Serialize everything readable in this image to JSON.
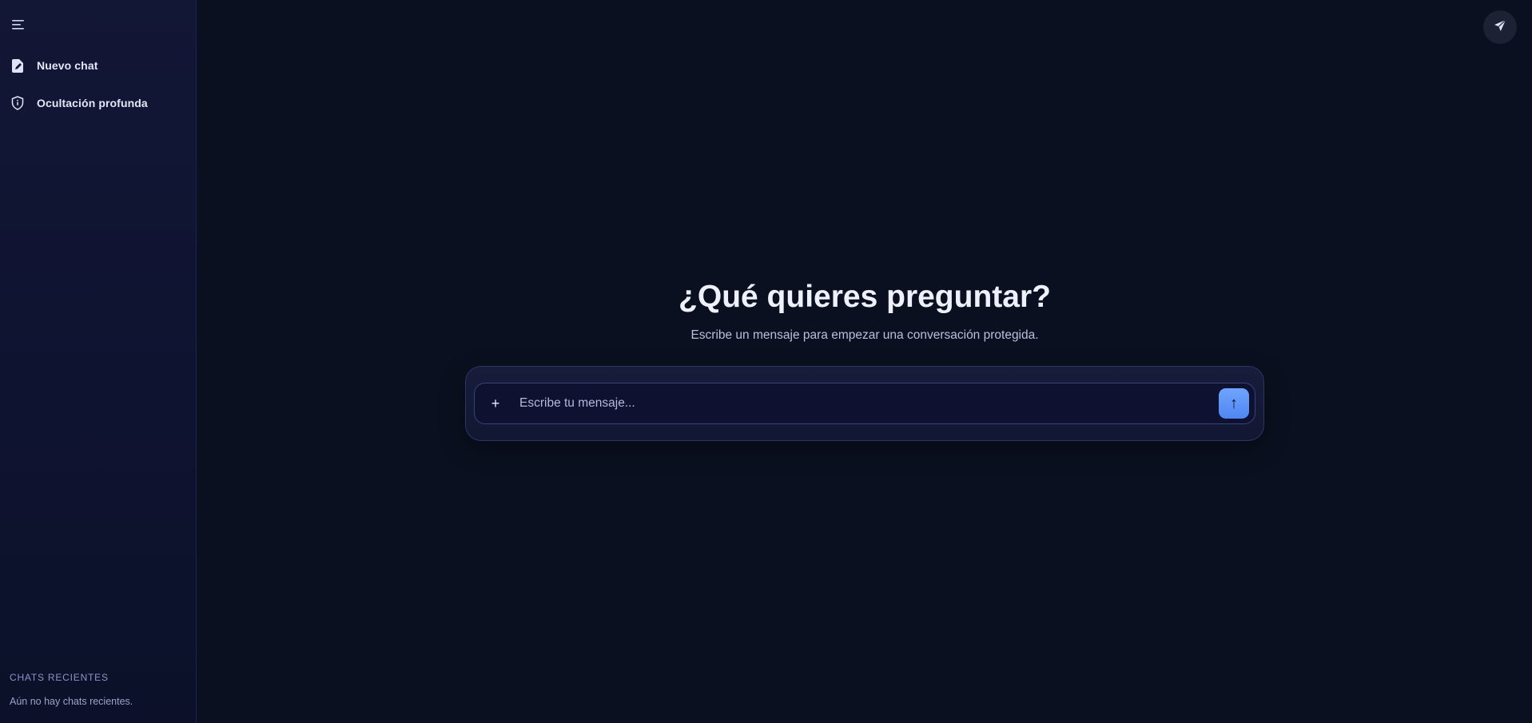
{
  "sidebar": {
    "menu_icon": "menu-icon",
    "items": [
      {
        "label": "Nuevo chat",
        "icon": "new-chat-icon"
      },
      {
        "label": "Ocultación profunda",
        "icon": "shield-icon"
      }
    ],
    "recent_title": "CHATS RECIENTES",
    "recent_empty": "Aún no hay chats recientes."
  },
  "topbar": {
    "action_icon": "send-plane-icon"
  },
  "main": {
    "title": "¿Qué quieres preguntar?",
    "subtitle": "Escribe un mensaje para empezar una conversación protegida.",
    "composer": {
      "attach_label": "+",
      "placeholder": "Escribe tu mensaje...",
      "send_label": "↑"
    }
  },
  "colors": {
    "background": "#0b1020",
    "sidebar": "#0e1330",
    "accent": "#5b90f5"
  }
}
